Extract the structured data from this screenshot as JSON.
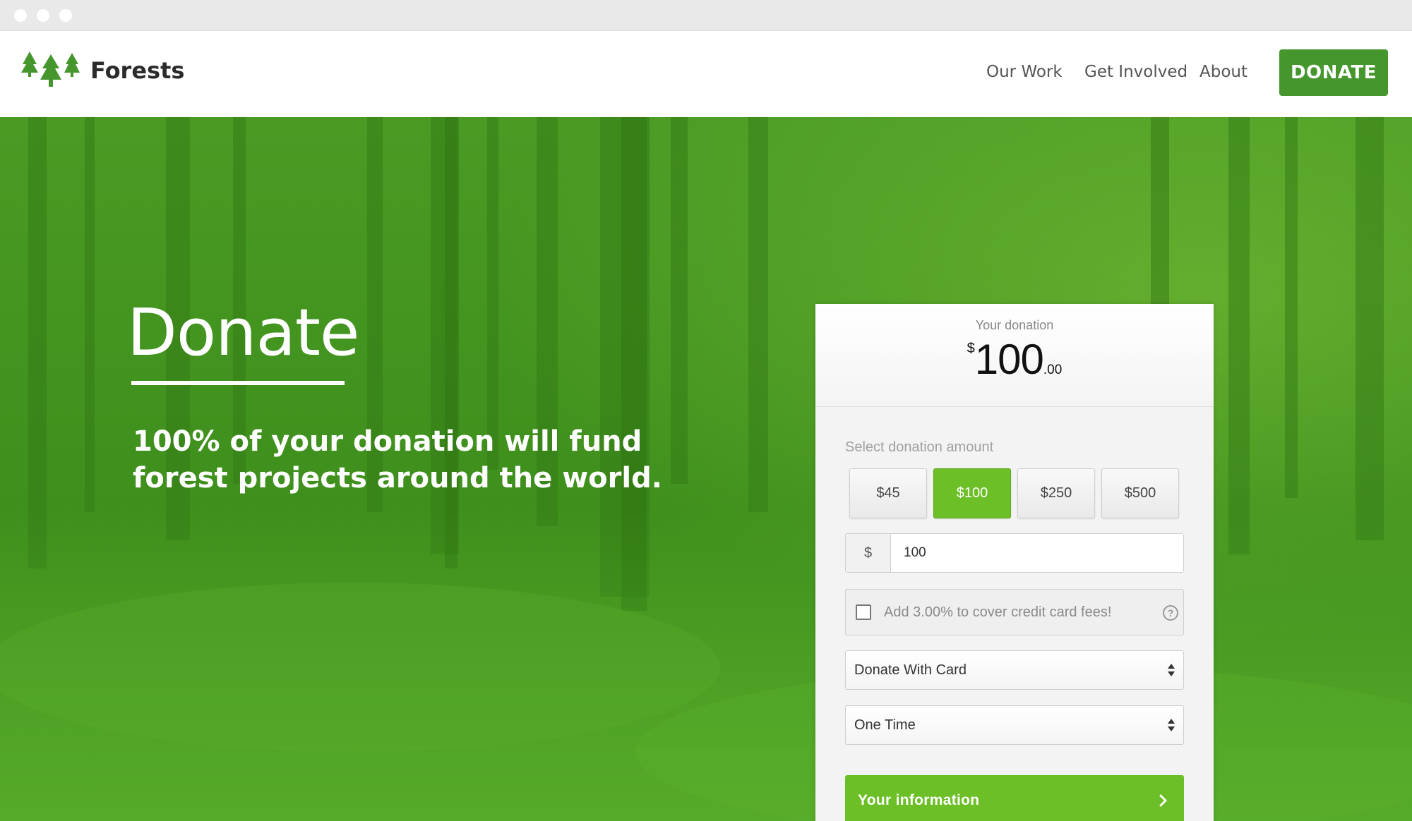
{
  "brand": {
    "name": "Forests"
  },
  "nav": {
    "links": [
      "Our Work",
      "Get Involved",
      "About"
    ],
    "donate_label": "DONATE"
  },
  "hero": {
    "title": "Donate",
    "subtitle": "100% of your donation will fund forest projects around the world."
  },
  "donation_card": {
    "header_label": "Your donation",
    "amount": {
      "currency": "$",
      "whole": "100",
      "cents": ".00"
    },
    "select_label": "Select donation amount",
    "preset_amounts": [
      "$45",
      "$100",
      "$250",
      "$500"
    ],
    "selected_preset_index": 1,
    "custom_amount": {
      "currency": "$",
      "value": "100"
    },
    "cover_fees": {
      "label": "Add 3.00% to cover credit card fees!",
      "checked": false,
      "help_icon": "question-circle-icon"
    },
    "payment_method": {
      "value": "Donate With Card",
      "icon": "sort-arrows-icon"
    },
    "frequency": {
      "value": "One Time",
      "icon": "sort-arrows-icon"
    },
    "submit": {
      "label": "Your information",
      "icon": "chevron-right-icon"
    }
  },
  "colors": {
    "brand_green": "#46962e",
    "accent_green": "#6cbf26",
    "hero_overlay": "#3f8f1d"
  }
}
